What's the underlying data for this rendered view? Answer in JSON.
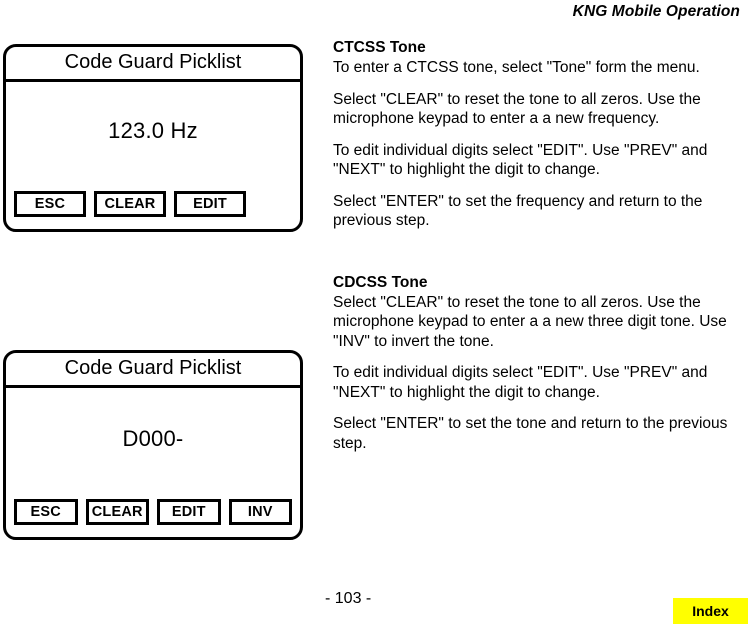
{
  "header": {
    "title": "KNG Mobile Operation"
  },
  "panels": [
    {
      "id": "ctcss",
      "title": "Code Guard Picklist",
      "value": "123.0 Hz",
      "softkeys": [
        "ESC",
        "CLEAR",
        "EDIT"
      ]
    },
    {
      "id": "cdcss",
      "title": "Code Guard Picklist",
      "value": "D000-",
      "softkeys": [
        "ESC",
        "CLEAR",
        "EDIT",
        "INV"
      ]
    }
  ],
  "sections": [
    {
      "heading": "CTCSS Tone",
      "paragraphs": [
        "To enter a CTCSS tone, select \"Tone\" form the menu.",
        "Select \"CLEAR\" to reset the tone to all zeros. Use the microphone keypad to enter a a new frequency.",
        "To edit individual digits select \"EDIT\". Use \"PREV\" and \"NEXT\" to highlight the digit to change.",
        "Select \"ENTER\" to set the frequency and return to the previous step."
      ]
    },
    {
      "heading": "CDCSS Tone",
      "paragraphs": [
        "Select \"CLEAR\" to reset the tone to all zeros. Use the microphone keypad to enter a a new three digit tone. Use \"INV\" to invert the tone.",
        "To edit individual digits select \"EDIT\". Use \"PREV\" and \"NEXT\" to highlight the digit to change.",
        "Select \"ENTER\" to set the tone and return to the previous step."
      ]
    }
  ],
  "footer": {
    "page_number": "- 103 -",
    "index_label": "Index",
    "index_color": "#ffff00"
  }
}
